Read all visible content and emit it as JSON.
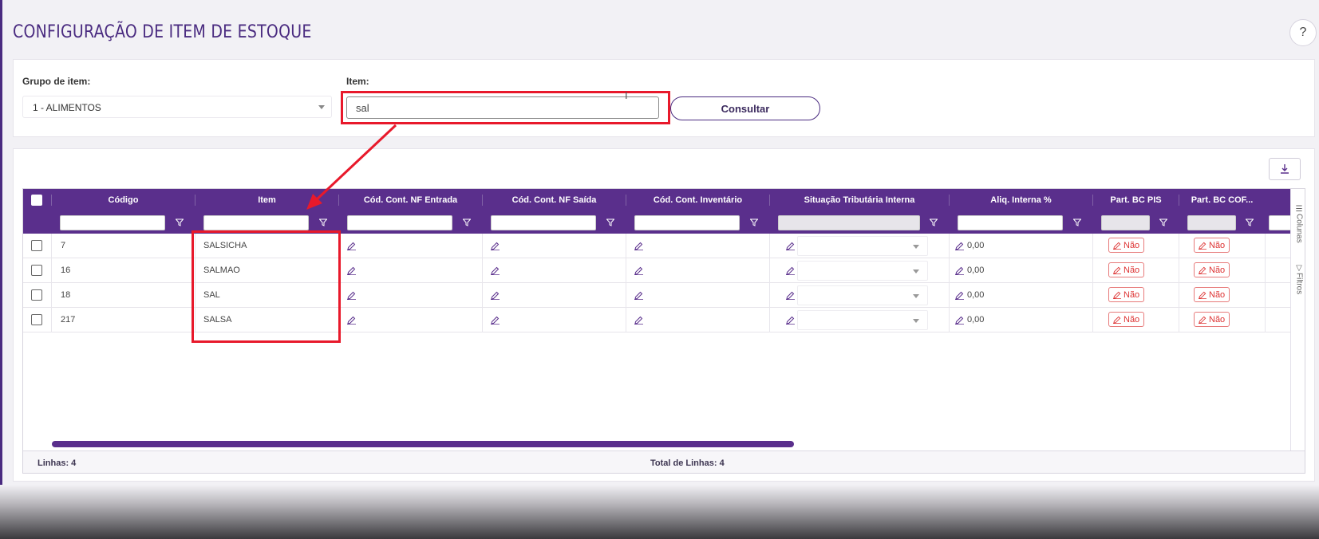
{
  "page": {
    "title": "CONFIGURAÇÃO DE ITEM DE ESTOQUE",
    "help_label": "?"
  },
  "filters": {
    "group_label": "Grupo de item:",
    "group_value": "1 - ALIMENTOS",
    "item_label": "Item:",
    "item_value": "sal",
    "query_button": "Consultar"
  },
  "grid": {
    "columns": [
      "Código",
      "Item",
      "Cód. Cont. NF Entrada",
      "Cód. Cont. NF Saída",
      "Cód. Cont. Inventário",
      "Situação Tributária Interna",
      "Aliq. Interna %",
      "Part. BC PIS",
      "Part. BC COF..."
    ],
    "rows": [
      {
        "codigo": "7",
        "item": "SALSICHA",
        "aliq": "0,00",
        "pis": "Não",
        "cofins": "Não"
      },
      {
        "codigo": "16",
        "item": "SALMAO",
        "aliq": "0,00",
        "pis": "Não",
        "cofins": "Não"
      },
      {
        "codigo": "18",
        "item": "SAL",
        "aliq": "0,00",
        "pis": "Não",
        "cofins": "Não"
      },
      {
        "codigo": "217",
        "item": "SALSA",
        "aliq": "0,00",
        "pis": "Não",
        "cofins": "Não"
      }
    ],
    "side_tabs": {
      "columns": "Colunas",
      "filters": "Filtros"
    },
    "footer": {
      "lines": "Linhas: 4",
      "total": "Total de Linhas: 4"
    }
  },
  "colors": {
    "accent": "#5a2f8c",
    "annotation": "#e8192b",
    "no_badge": "#d33333"
  },
  "icons": [
    "help-icon",
    "download-icon",
    "funnel-icon",
    "pencil-icon",
    "chevron-down-icon",
    "columns-icon",
    "text-cursor-icon"
  ]
}
